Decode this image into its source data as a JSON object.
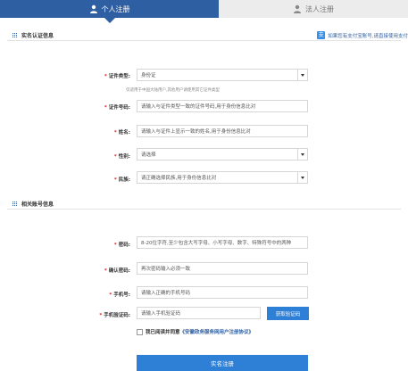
{
  "tabs": {
    "personal": "个人注册",
    "legal": "法人注册"
  },
  "sections": {
    "identity": "实名认证信息",
    "account": "相关账号信息"
  },
  "notice": "如果您有支付宝账号,请直接使用支付",
  "identity": {
    "id_type_label": "证件类型:",
    "id_type_value": "身份证",
    "id_type_hint": "仅适用于中国大陆用户,其他用户请使用其它证件类型",
    "id_number_label": "证件号码:",
    "id_number_placeholder": "请输入与证件类型一致的证件号码,用于身份信息比对",
    "name_label": "姓名:",
    "name_placeholder": "请输入与证件上显示一致的姓名,用于身份信息比对",
    "gender_label": "性别:",
    "gender_value": "请选择",
    "ethnicity_label": "民族:",
    "ethnicity_value": "请正确选择民族,用于身份信息比对"
  },
  "account": {
    "password_label": "密码:",
    "password_placeholder": "8-20位字符,至少包含大写字母、小写字母、数字、特殊符号中的两种",
    "confirm_label": "确认密码:",
    "confirm_placeholder": "再次密码输入必须一致",
    "phone_label": "手机号:",
    "phone_placeholder": "请输入正确的手机号码",
    "code_label": "手机验证码:",
    "code_placeholder": "请输入手机验证码",
    "code_button": "获取验证码"
  },
  "agreement": {
    "prefix": "我已阅读并同意",
    "link": "《安徽政务服务网用户注册协议》"
  },
  "submit": "实名注册",
  "colors": {
    "primary": "#2e5fa3",
    "button": "#2e7fd6",
    "required": "#e02020"
  }
}
